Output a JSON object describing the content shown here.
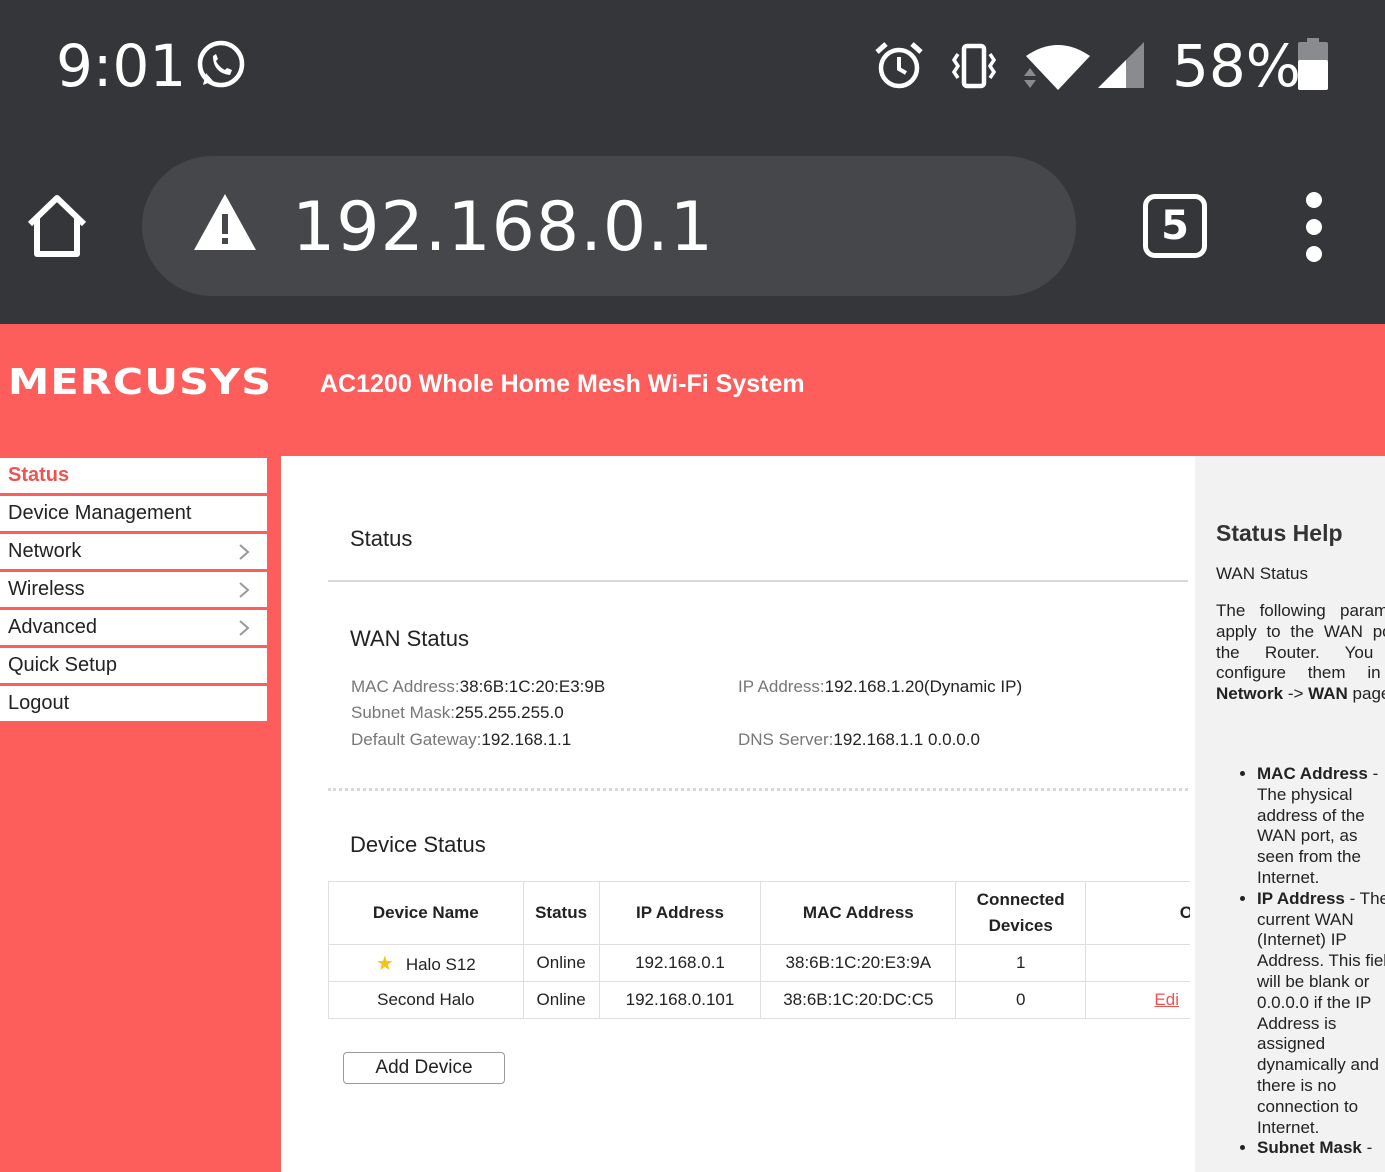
{
  "status_bar": {
    "time": "9:01",
    "battery_percent": "58%",
    "battery_level": 0.58,
    "icons": [
      "whatsapp-icon",
      "alarm-icon",
      "vibrate-icon",
      "wifi-icon",
      "cell-signal-icon",
      "battery-icon"
    ]
  },
  "browser": {
    "url": "192.168.0.1",
    "tab_count": "5",
    "icons": [
      "home-icon",
      "warning-icon",
      "tabs-icon",
      "more-vert-icon"
    ]
  },
  "header": {
    "logo": "MERCUSYS",
    "product": "AC1200 Whole Home Mesh Wi-Fi System",
    "accent_color": "#fd5e5c"
  },
  "nav": {
    "items": [
      {
        "label": "Status",
        "active": true
      },
      {
        "label": "Device Management"
      },
      {
        "label": "Network",
        "has_submenu": true
      },
      {
        "label": "Wireless",
        "has_submenu": true
      },
      {
        "label": "Advanced",
        "has_submenu": true
      },
      {
        "label": "Quick Setup"
      },
      {
        "label": "Logout"
      }
    ]
  },
  "main": {
    "title": "Status",
    "wan": {
      "title": "WAN Status",
      "mac_label": "MAC Address:",
      "mac_value": "38:6B:1C:20:E3:9B",
      "subnet_label": "Subnet Mask:",
      "subnet_value": "255.255.255.0",
      "gateway_label": "Default Gateway:",
      "gateway_value": "192.168.1.1",
      "ip_label": "IP Address:",
      "ip_value": "192.168.1.20(Dynamic IP)",
      "dns_label": "DNS Server:",
      "dns_value": "192.168.1.1 0.0.0.0"
    },
    "devices": {
      "title": "Device Status",
      "headers": [
        "Device Name",
        "Status",
        "IP Address",
        "MAC Address",
        "Connected Devices",
        "O"
      ],
      "rows": [
        {
          "name": "Halo S12",
          "status": "Online",
          "ip": "192.168.0.1",
          "mac": "38:6B:1C:20:E3:9A",
          "connected": "1",
          "op": "",
          "main": true
        },
        {
          "name": "Second Halo",
          "status": "Online",
          "ip": "192.168.0.101",
          "mac": "38:6B:1C:20:DC:C5",
          "connected": "0",
          "op": "Edi"
        }
      ],
      "add_label": "Add Device"
    }
  },
  "help": {
    "title": "Status Help",
    "subtitle": "WAN Status",
    "para_pre": "The following parameters apply to the WAN port of the Router. You can configure them in the",
    "para_link1": "Network",
    "para_arrow": "->",
    "para_link2": "WAN",
    "para_post": "page.",
    "items": [
      {
        "term": "MAC Address",
        "text": "- The physical address of the WAN port, as seen from the Internet."
      },
      {
        "term": "IP Address",
        "text": "- The current WAN (Internet) IP Address. This field will be blank or 0.0.0.0 if the IP Address is assigned dynamically and there is no connection to Internet."
      },
      {
        "term": "Subnet Mask",
        "text": "-"
      }
    ]
  }
}
